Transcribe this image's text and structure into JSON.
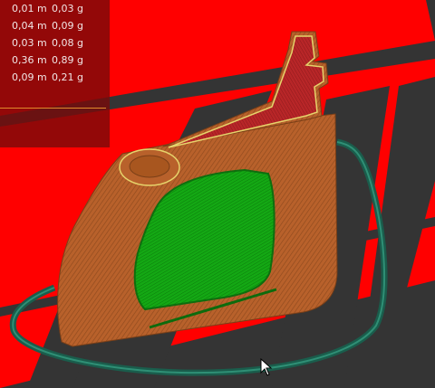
{
  "legend": {
    "rows": [
      {
        "length": "0,01 m",
        "weight": "0,03 g"
      },
      {
        "length": "0,04 m",
        "weight": "0,09 g"
      },
      {
        "length": "0,03 m",
        "weight": "0,08 g"
      },
      {
        "length": "0,36 m",
        "weight": "0,89 g"
      },
      {
        "length": "0,09 m",
        "weight": "0,21 g"
      }
    ]
  },
  "colors": {
    "bed_red": "#ff0000",
    "bed_dark": "#333333",
    "perimeter_orange": "#b8612b",
    "infill_red": "#b82628",
    "top_green": "#10a010",
    "skirt_teal": "#1f6f5c"
  }
}
